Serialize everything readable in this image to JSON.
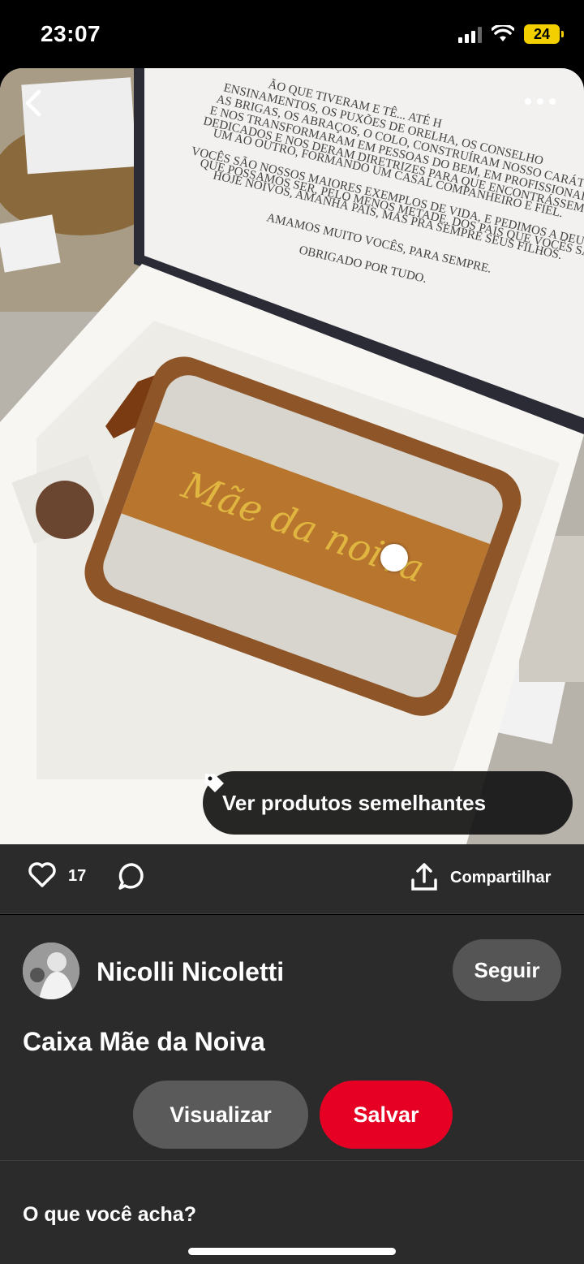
{
  "status_bar": {
    "time": "23:07",
    "battery_level": "24",
    "icons": [
      "cellular-signal-icon",
      "wifi-icon",
      "battery-charging-icon"
    ]
  },
  "photo": {
    "letter_lines": [
      "ENSINAMENTOS, OS PUXÕES DE ORELHA, OS CONSELHO",
      "AS BRIGAS, OS ABRAÇOS, O COLO, CONSTRUÍRAM NOSSO CARÁTER",
      "E NOS TRANSFORMARAM EM PESSOAS DO BEM, EM PROFISSIONAIS",
      "DEDICADOS E NOS DERAM DIRETRIZES PARA QUE ENCONTRÁSSEMOS",
      "UM AO OUTRO, FORMANDO UM CASAL COMPANHEIRO E FIEL.",
      "VOCÊS SÃO NOSSOS MAIORES EXEMPLOS DE VIDA, E PEDIMOS A DEUS PARA",
      "QUE POSSAMOS SER, PELO MENOS METADE, DOS PAIS QUE VOCÊS SÃO.",
      "HOJE NOIVOS, AMANHÃ PAIS, MAS PRA SEMPRE SEUS FILHOS.",
      "AMAMOS MUITO VOCÊS, PARA SEMPRE.",
      "OBRIGADO POR TUDO."
    ],
    "letter_top": "ÃO QUE TIVERAM E TÊ... ATÉ H",
    "bag_text": "Mãe da noiva",
    "similar_label": "Ver produtos semelhantes"
  },
  "actions": {
    "like_count": "17",
    "share_label": "Compartilhar"
  },
  "details": {
    "user_name": "Nicolli Nicoletti",
    "follow_label": "Seguir",
    "title": "Caixa Mãe da Noiva",
    "visualize_label": "Visualizar",
    "save_label": "Salvar",
    "prompt": "O que você acha?"
  },
  "colors": {
    "save": "#e60023",
    "panel": "#2b2b2b",
    "button_gray": "#5a5a5a",
    "battery": "#f4cf00",
    "bag_leather": "#b8752e"
  }
}
